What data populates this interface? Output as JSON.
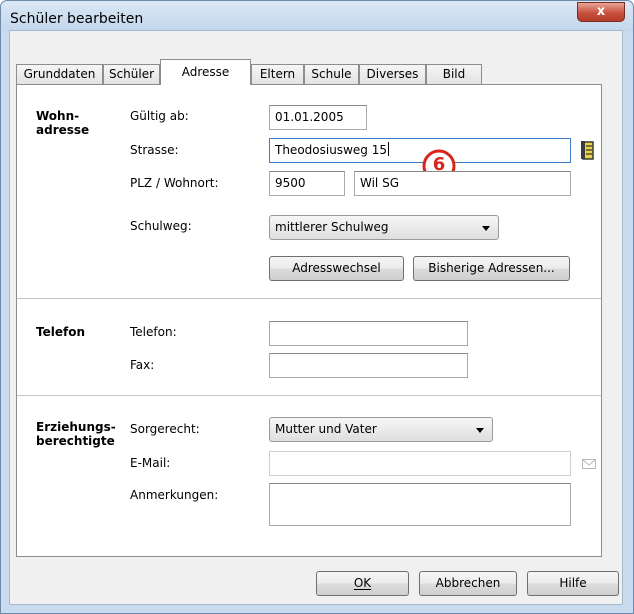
{
  "window": {
    "title": "Schüler bearbeiten",
    "close_glyph": "x"
  },
  "tabs": [
    {
      "label": "Grunddaten",
      "active": false
    },
    {
      "label": "Schüler",
      "active": false
    },
    {
      "label": "Adresse",
      "active": true
    },
    {
      "label": "Eltern",
      "active": false
    },
    {
      "label": "Schule",
      "active": false
    },
    {
      "label": "Diverses",
      "active": false
    },
    {
      "label": "Bild",
      "active": false
    }
  ],
  "wohnadresse": {
    "title_line1": "Wohn-",
    "title_line2": "adresse",
    "gueltig_label": "Gültig ab:",
    "gueltig_value": "01.01.2005",
    "strasse_label": "Strasse:",
    "strasse_value": "Theodosiusweg 15",
    "plz_label": "PLZ / Wohnort:",
    "plz_value": "9500",
    "ort_value": "Wil SG",
    "schulweg_label": "Schulweg:",
    "schulweg_value": "mittlerer Schulweg",
    "adresswechsel_button": "Adresswechsel",
    "bisherige_button": "Bisherige Adressen...",
    "marker_number": "6"
  },
  "telefon": {
    "title": "Telefon",
    "telefon_label": "Telefon:",
    "telefon_value": "",
    "fax_label": "Fax:",
    "fax_value": ""
  },
  "erziehung": {
    "title_line1": "Erziehungs-",
    "title_line2": "berechtigte",
    "sorgerecht_label": "Sorgerecht:",
    "sorgerecht_value": "Mutter und Vater",
    "email_label": "E-Mail:",
    "email_value": "",
    "anmerkungen_label": "Anmerkungen:",
    "anmerkungen_value": ""
  },
  "footer": {
    "ok_label": "OK",
    "abbrechen_label": "Abbrechen",
    "hilfe_label": "Hilfe"
  },
  "colors": {
    "marker": "#d8261c",
    "accent": "#3d7bc6"
  }
}
